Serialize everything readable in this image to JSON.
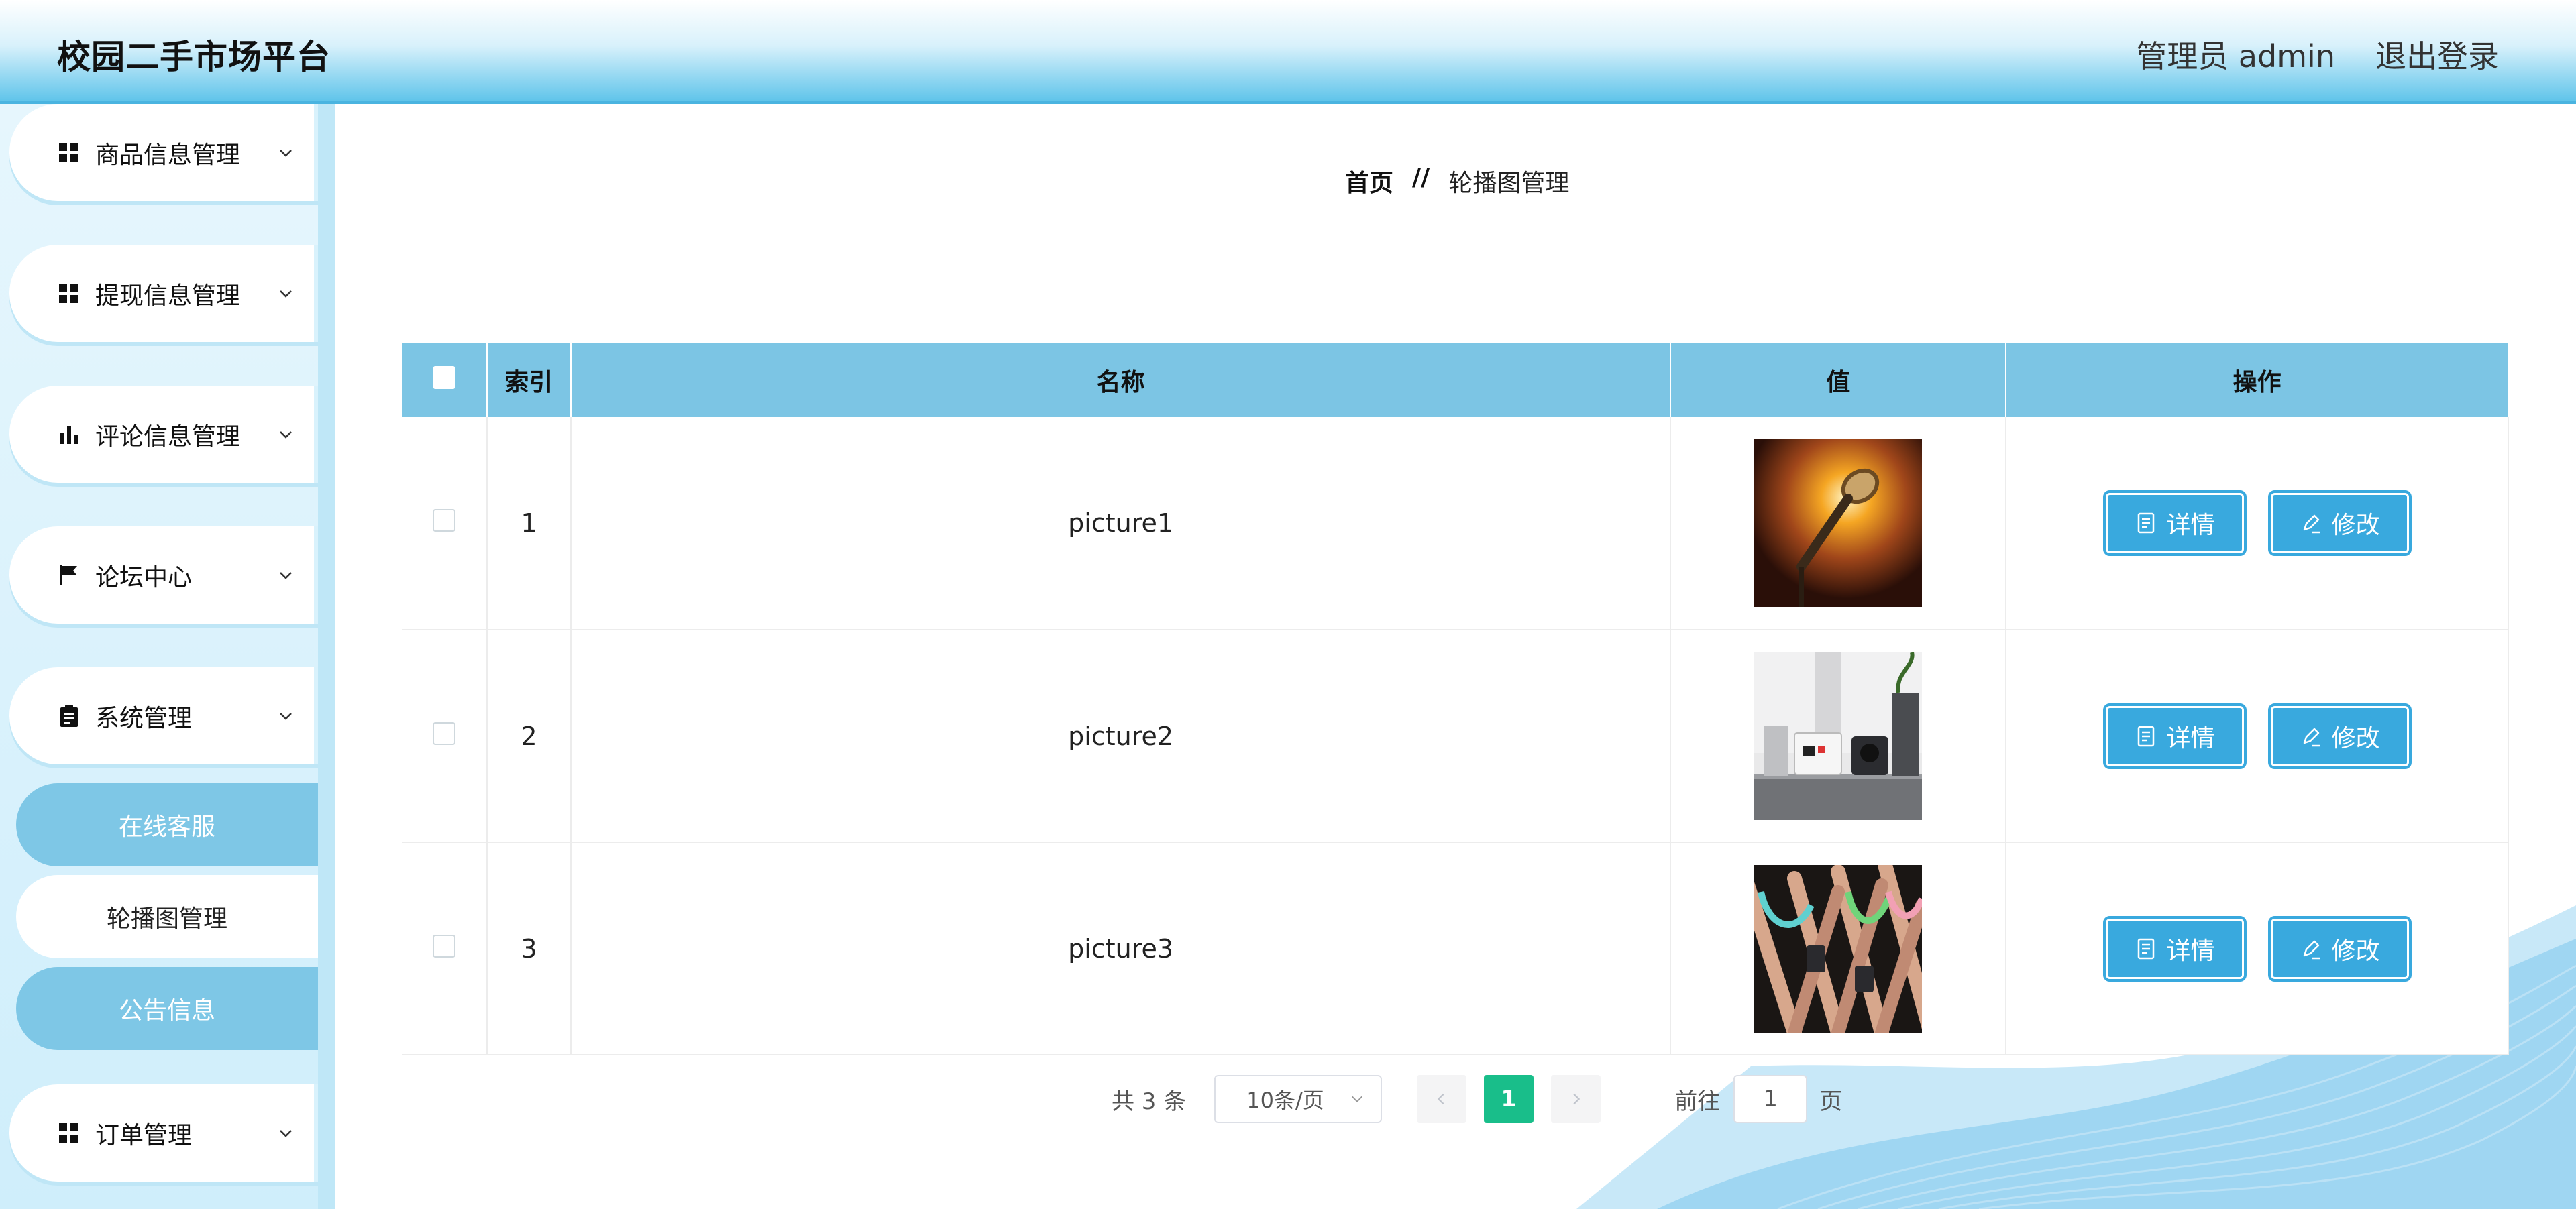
{
  "header": {
    "brand": "校园二手市场平台",
    "admin_label": "管理员 admin",
    "logout_label": "退出登录"
  },
  "sidebar": {
    "items": [
      {
        "label": "商品信息管理",
        "icon": "grid-icon"
      },
      {
        "label": "提现信息管理",
        "icon": "grid-icon"
      },
      {
        "label": "评论信息管理",
        "icon": "bar-chart-icon"
      },
      {
        "label": "论坛中心",
        "icon": "flag-icon"
      },
      {
        "label": "系统管理",
        "icon": "clipboard-icon"
      },
      {
        "label": "订单管理",
        "icon": "grid-icon"
      }
    ],
    "sub_items": [
      {
        "label": "在线客服",
        "active": false
      },
      {
        "label": "轮播图管理",
        "active": true
      },
      {
        "label": "公告信息",
        "active": false
      }
    ]
  },
  "breadcrumb": {
    "home": "首页",
    "separator": "//",
    "current": "轮播图管理"
  },
  "table": {
    "headers": [
      "索引",
      "名称",
      "值",
      "操作"
    ],
    "rows": [
      {
        "index": "1",
        "name": "picture1",
        "image": "microphone"
      },
      {
        "index": "2",
        "name": "picture2",
        "image": "desk-devices"
      },
      {
        "index": "3",
        "name": "picture3",
        "image": "abstract-phones"
      }
    ],
    "detail_label": "详情",
    "edit_label": "修改"
  },
  "pagination": {
    "total": "共 3 条",
    "page_size": "10条/页",
    "current_page": "1",
    "goto_label": "前往",
    "goto_value": "1",
    "page_suffix": "页"
  },
  "colors": {
    "header_accent": "#4ab4e0",
    "table_header": "#7cc5e4",
    "button": "#39a9de",
    "pager_active": "#19be8a"
  }
}
